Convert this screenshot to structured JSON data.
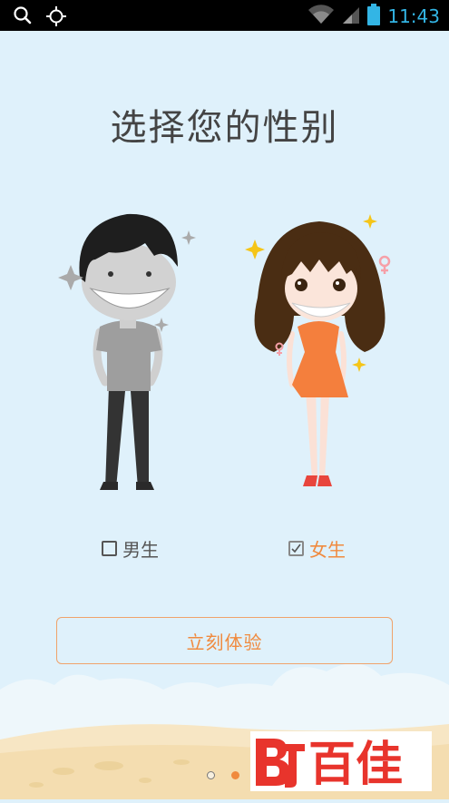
{
  "status_bar": {
    "time": "11:43",
    "icons": [
      "search-icon",
      "gps-icon",
      "wifi-icon",
      "signal-icon",
      "battery-icon"
    ]
  },
  "page": {
    "title": "选择您的性别"
  },
  "gender_options": [
    {
      "label": "男生",
      "checked": false,
      "color": "#555555"
    },
    {
      "label": "女生",
      "checked": true,
      "color": "#f08a3e"
    }
  ],
  "cta": {
    "label": "立刻体验"
  },
  "pager": {
    "total": 2,
    "current": 2
  },
  "watermark": {
    "text": "百佳"
  },
  "colors": {
    "background": "#dff1fb",
    "accent": "#f08a3e",
    "status_accent": "#33b5e5"
  }
}
